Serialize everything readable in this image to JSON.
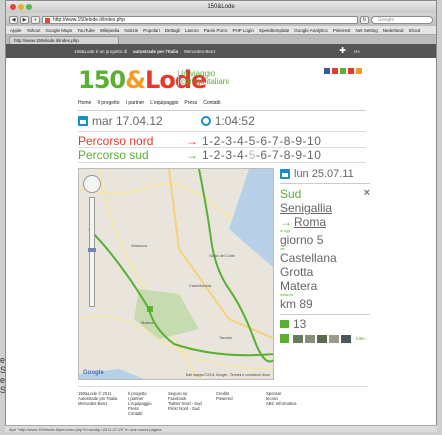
{
  "window": {
    "title": "150&Lode",
    "url": "http://www.150elode.it/index.php",
    "search_placeholder": "Google",
    "tab_label": "http://www.150elode.it/index.php"
  },
  "bookmarks": [
    "Apple",
    "Yahoo!",
    "Google Maps",
    "YouTube",
    "Wikipedia",
    "Notizie",
    "Popolari",
    "Dettagli",
    "Lavoro",
    "Paolo Porro",
    "PHP Login",
    "Speedtemplate",
    "Google Analytics",
    "Pinterest",
    "Net Setting",
    "Nederland",
    "Shoot"
  ],
  "site_bar": {
    "left": "150&Lode è un progetto di",
    "brand": "autostrade per l'Italia",
    "partner": "Mercedes-Benz",
    "me": "Me"
  },
  "logo": {
    "p1": "150",
    "amp": "&",
    "p2": "Lode"
  },
  "tagline": {
    "line1": "In viaggio",
    "line2": "con gli italiani"
  },
  "nav": [
    "Home",
    "Il progetto",
    "I partner",
    "L'equipaggio",
    "Press",
    "Contatti"
  ],
  "date_row": {
    "date": "mar 17.04.12",
    "time": "1:04:52"
  },
  "routes": {
    "nord": {
      "label": "Percorso nord",
      "arrow": "→",
      "stages": "1-2-3-4-5-6-7-8-9-10"
    },
    "sud": {
      "label": "Percorso sud",
      "arrow": "→",
      "stages_a": "1-2-3-4-",
      "stages_b": "5",
      "stages_c": "-6-7-8-9-10"
    }
  },
  "map": {
    "logo": "Google",
    "copyright": "Dati mappa ©2011 Google - Termini e condizioni d'uso"
  },
  "panel": {
    "date": "lun 25.07.11",
    "route": "Sud",
    "close": "×",
    "from": "Senigallia",
    "to": "Roma",
    "day_label": "di oggi",
    "day": "giorno 5",
    "via_label": "via",
    "via1": "Castellana",
    "via2": "Grotta",
    "via3": "Matera",
    "distance_label": "distanza",
    "distance": "km 89",
    "photos_count": "13",
    "all_link": "tutte ›"
  },
  "footer": {
    "c1": [
      "150&Lode © 2011",
      "Autostrade per l'Italia",
      "Mercedes-Benz"
    ],
    "c2": [
      "Il progetto",
      "I partner",
      "L'equipaggio",
      "Press",
      "Contatti"
    ],
    "c3": [
      "Seguici su",
      "Facebook",
      "Twitter Nord - Sud",
      "Flickr Nord - Sud"
    ],
    "c4": [
      "Credits",
      "Powered"
    ],
    "c5": [
      "Sponsor",
      "tecnici",
      "ABC Informatica"
    ]
  },
  "status_bar": "Apri \"http://www.150elode.it/percorso.php?b=sud&p=2011-07-25\" in una nuova pagina",
  "desktop_text": [
    "e",
    "S",
    "e",
    "S"
  ],
  "colors": {
    "green": "#5bb033",
    "red": "#e43a2d",
    "orange": "#f59a27",
    "blue": "#1a8fc7"
  }
}
